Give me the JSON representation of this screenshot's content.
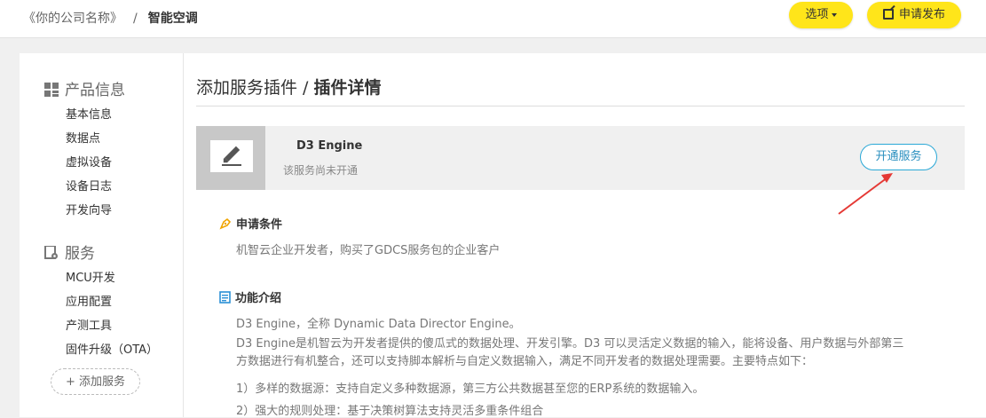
{
  "header": {
    "company": "《你的公司名称》",
    "separator": "/",
    "product": "智能空调",
    "options_label": "选项",
    "publish_label": "申请发布"
  },
  "sidebar": {
    "product_group": "产品信息",
    "product_items": [
      "基本信息",
      "数据点",
      "虚拟设备",
      "设备日志",
      "开发向导"
    ],
    "service_group": "服务",
    "service_items": [
      "MCU开发",
      "应用配置",
      "产测工具",
      "固件升级（OTA）"
    ],
    "add_service": "+ 添加服务"
  },
  "main": {
    "title_prefix": "添加服务插件 / ",
    "title_current": "插件详情",
    "plugin": {
      "name": "D3 Engine",
      "status": "该服务尚未开通",
      "activate_label": "开通服务"
    },
    "conditions": {
      "heading": "申请条件",
      "text": "机智云企业开发者，购买了GDCS服务包的企业客户"
    },
    "intro": {
      "heading": "功能介绍",
      "line1": "D3 Engine，全称 Dynamic Data Director Engine。",
      "para": "D3 Engine是机智云为开发者提供的傻瓜式的数据处理、开发引擎。D3 可以灵活定义数据的输入，能将设备、用户数据与外部第三方数据进行有机整合，还可以支持脚本解析与自定义数据输入，满足不同开发者的数据处理需要。主要特点如下：",
      "point1": "1）多样的数据源：支持自定义多种数据源，第三方公共数据甚至您的ERP系统的数据输入。",
      "point2": "2）强大的规则处理：基于决策树算法支持灵活多重条件组合"
    }
  },
  "colors": {
    "accent_yellow": "#ffe51a",
    "link_blue": "#2aa8d6",
    "annotation_red": "#e53935"
  }
}
